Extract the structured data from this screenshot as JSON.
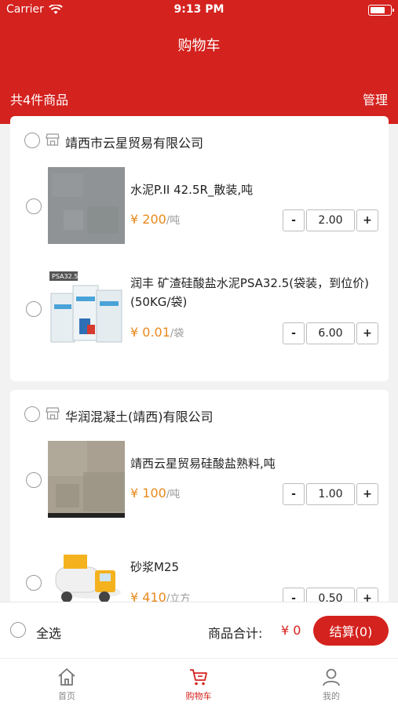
{
  "status_bar": {
    "carrier": "Carrier",
    "time": "9:13 PM"
  },
  "header": {
    "title": "购物车",
    "count": "共4件商品",
    "manage": "管理"
  },
  "stores": [
    {
      "name": "靖西市云星贸易有限公司",
      "items": [
        {
          "name": "水泥P.II 42.5R_散装,吨",
          "currency": "¥",
          "price": "200",
          "unit": "/吨",
          "qty": "2.00",
          "image": "cement-bulk"
        },
        {
          "name": "润丰 矿渣硅酸盐水泥PSA32.5(袋装，到位价) (50KG/袋)",
          "currency": "¥",
          "price": "0.01",
          "unit": "/袋",
          "qty": "6.00",
          "image": "cement-bags",
          "image_label": "PSA32.5"
        }
      ]
    },
    {
      "name": "华润混凝土(靖西)有限公司",
      "items": [
        {
          "name": "靖西云星贸易硅酸盐熟料,吨",
          "currency": "¥",
          "price": "100",
          "unit": "/吨",
          "qty": "1.00",
          "image": "clinker"
        },
        {
          "name": "砂浆M25",
          "currency": "¥",
          "price": "410",
          "unit": "/立方",
          "qty": "0.50",
          "image": "mixer-truck"
        }
      ]
    }
  ],
  "stepper": {
    "minus": "-",
    "plus": "+"
  },
  "footer": {
    "select_all": "全选",
    "total_label": "商品合计:",
    "total_currency": "¥",
    "total_value": "0",
    "checkout": "结算(0)"
  },
  "tabs": [
    {
      "label": "首页",
      "icon": "home-icon"
    },
    {
      "label": "购物车",
      "icon": "cart-icon"
    },
    {
      "label": "我的",
      "icon": "user-icon"
    }
  ],
  "colors": {
    "brand": "#d4221e",
    "price": "#e8891c",
    "background": "#f2f2f2"
  }
}
